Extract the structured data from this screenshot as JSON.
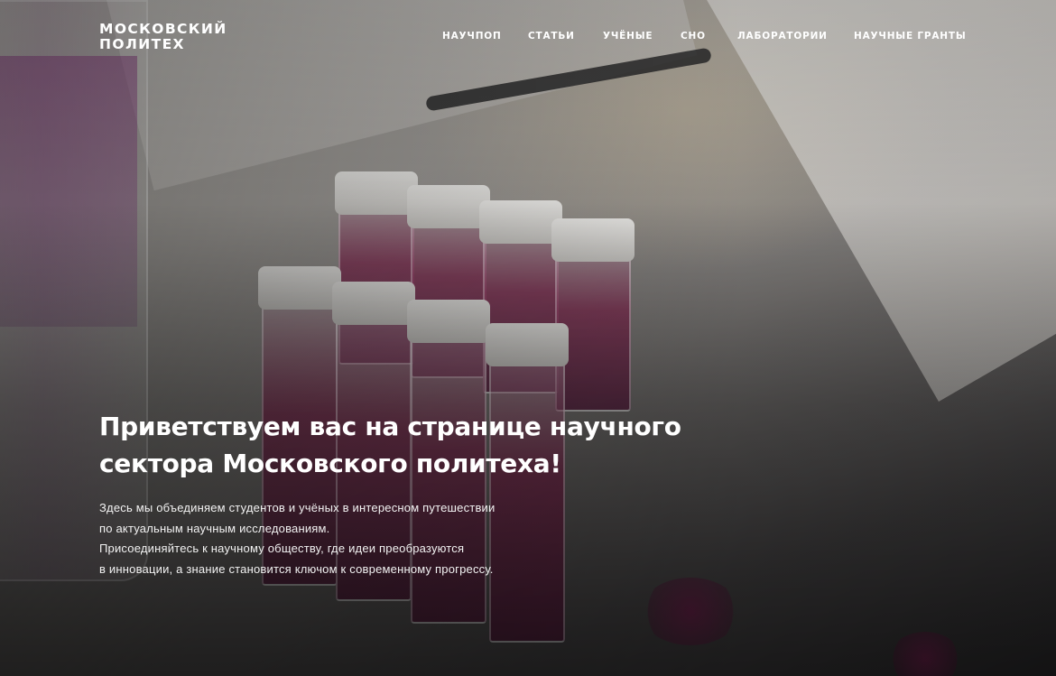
{
  "logo": {
    "line1": "МОСКОВСКИЙ",
    "line2": "ПОЛИТЕХ"
  },
  "nav": {
    "items": [
      {
        "label": "НАУЧПОП"
      },
      {
        "label": "СТАТЬИ"
      },
      {
        "label": "УЧЁНЫЕ"
      },
      {
        "label": "СНО"
      },
      {
        "label": "ЛАБОРАТОРИИ"
      },
      {
        "label": "НАУЧНЫЕ ГРАНТЫ"
      }
    ]
  },
  "hero": {
    "title_lines": [
      "Приветствуем вас на странице научного",
      "сектора Московского политеха!"
    ],
    "description_lines": [
      "Здесь мы объединяем студентов и учёных в интересном путешествии",
      "по актуальным научным исследованиям.",
      "Присоединяйтесь к научному обществу, где идеи преобразуются",
      "в инновации, а знание становится ключом к современному прогрессу."
    ]
  }
}
